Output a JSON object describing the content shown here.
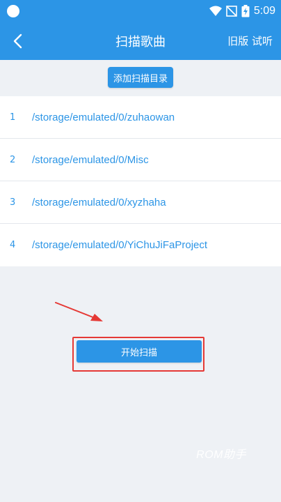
{
  "status_bar": {
    "time": "5:09"
  },
  "app_bar": {
    "title": "扫描歌曲",
    "right_action": "旧版 试听"
  },
  "toolbar": {
    "add_dir_label": "添加扫描目录"
  },
  "directories": [
    {
      "index": "1",
      "path": "/storage/emulated/0/zuhaowan"
    },
    {
      "index": "2",
      "path": "/storage/emulated/0/Misc"
    },
    {
      "index": "3",
      "path": "/storage/emulated/0/xyzhaha"
    },
    {
      "index": "4",
      "path": "/storage/emulated/0/YiChuJiFaProject"
    }
  ],
  "actions": {
    "start_scan_label": "开始扫描"
  },
  "watermark": "ROM助手",
  "colors": {
    "primary": "#2c95e6",
    "background": "#eef1f5",
    "highlight_box": "#e53935"
  },
  "icons": {
    "back": "chevron-left-icon",
    "wifi": "wifi-icon",
    "signal": "no-signal-icon",
    "battery": "battery-charging-icon"
  }
}
